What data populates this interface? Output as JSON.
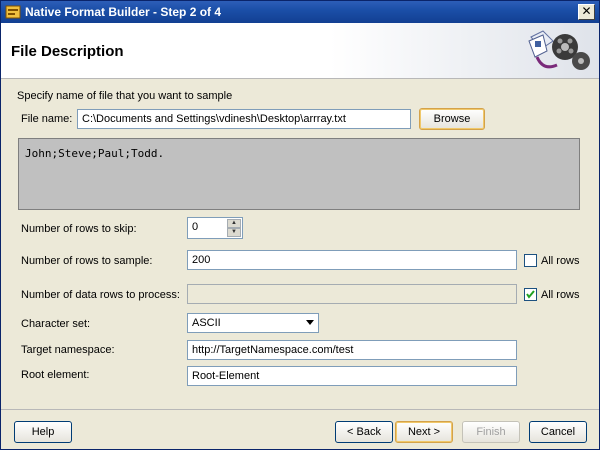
{
  "window": {
    "title": "Native Format Builder - Step 2 of 4",
    "close_glyph": "✕"
  },
  "header": {
    "heading": "File Description"
  },
  "form": {
    "instructions": "Specify name of file that you want to sample",
    "file_name_label": "File name:",
    "file_name_value": "C:\\Documents and Settings\\vdinesh\\Desktop\\arrray.txt",
    "browse_label": "Browse",
    "preview_text": "John;Steve;Paul;Todd.",
    "rows_skip_label": "Number of rows to skip:",
    "rows_skip_value": "0",
    "rows_sample_label": "Number of rows to sample:",
    "rows_sample_value": "200",
    "all_rows_label": "All rows",
    "all_rows_sample_checked": false,
    "data_rows_label": "Number of data rows to process:",
    "data_rows_value": "",
    "all_rows_process_checked": true,
    "charset_label": "Character set:",
    "charset_value": "ASCII",
    "namespace_label": "Target namespace:",
    "namespace_value": "http://TargetNamespace.com/test",
    "root_label": "Root element:",
    "root_value": "Root-Element"
  },
  "footer": {
    "help": "Help",
    "back": "< Back",
    "next": "Next >",
    "finish": "Finish",
    "cancel": "Cancel"
  },
  "icons": {
    "window": "app-icon",
    "logo": "native-format-builder-logo",
    "spinner": "spinner-arrows",
    "check": "checkmark-icon",
    "dropdown": "chevron-down-icon"
  }
}
